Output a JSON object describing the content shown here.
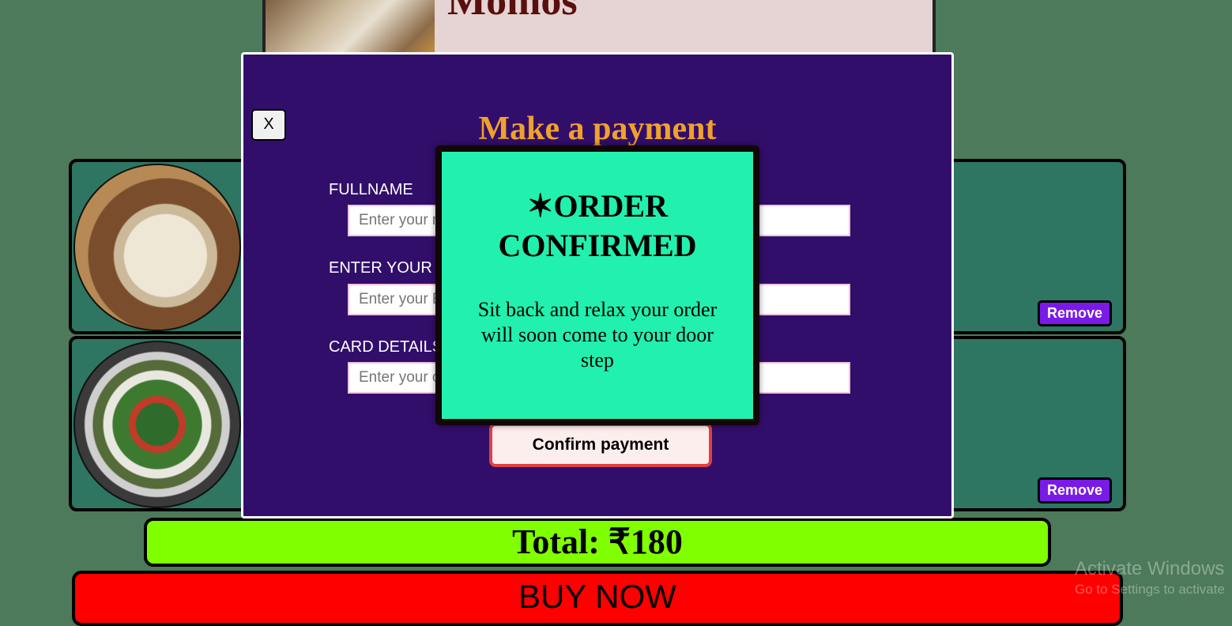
{
  "colors": {
    "background": "#4c7a5a",
    "cart_row": "#2e7562",
    "modal": "#320e6b",
    "modal_title": "#f0a12a",
    "confirm_box": "#21f0ae",
    "total_bar": "#80ff00",
    "buy_button": "#ff0000",
    "remove_button": "#7a1ae6"
  },
  "top_item": {
    "title": "Momos",
    "image_icon": "momos-photo"
  },
  "cart": {
    "items": [
      {
        "image_icon": "momos-photo",
        "remove_label": "Remove"
      },
      {
        "image_icon": "salad-photo",
        "remove_label": "Remove"
      }
    ],
    "total": "Total: ₹180",
    "buy_label": "BUY NOW"
  },
  "payment_modal": {
    "close_label": "X",
    "title": "Make a payment",
    "fields": [
      {
        "label": "FULLNAME",
        "placeholder": "Enter your n"
      },
      {
        "label": "ENTER YOUR I",
        "placeholder": "Enter your E"
      },
      {
        "label": "CARD DETAILS",
        "placeholder": "Enter your c"
      }
    ],
    "confirm_label": "Confirm payment"
  },
  "order_confirmation": {
    "title": "✶ORDER CONFIRMED",
    "message": "Sit back and relax your order will soon come to your door step"
  },
  "watermark": {
    "line1": "Activate Windows",
    "line2": "Go to Settings to activate"
  }
}
